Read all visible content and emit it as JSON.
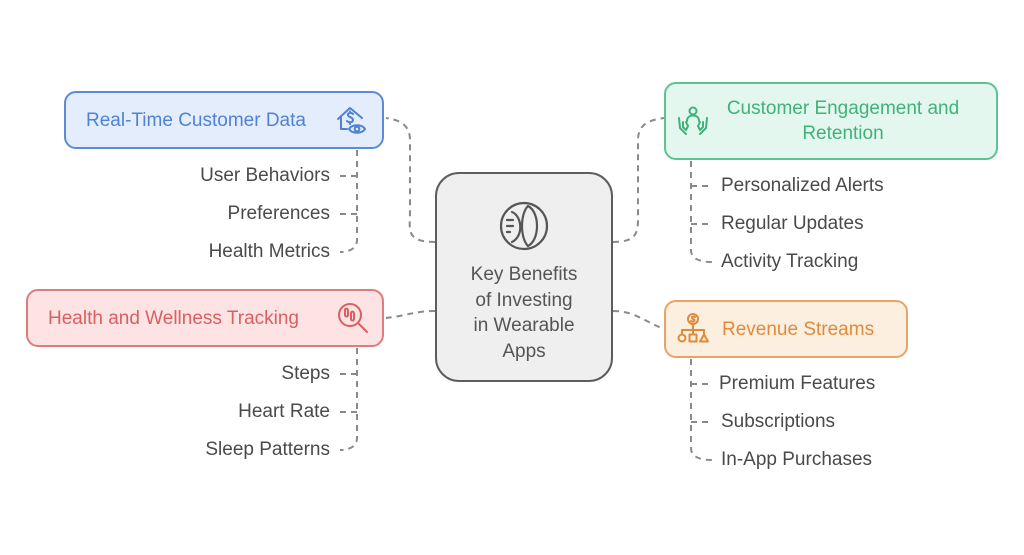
{
  "diagram": {
    "type": "mind-map",
    "center": {
      "title": "Key Benefits of Investing in Wearable Apps",
      "title_lines": [
        "Key Benefits",
        "of Investing",
        "in Wearable",
        "Apps"
      ],
      "icon": "smart-ring-icon",
      "color": "#5d5d5d"
    },
    "branches": [
      {
        "id": "realtime",
        "label": "Real-Time Customer Data",
        "icon": "house-dollar-eye-icon",
        "color": "#4f82d4",
        "fill": "#e4edfc",
        "items": [
          "User Behaviors",
          "Preferences",
          "Health Metrics"
        ]
      },
      {
        "id": "engage",
        "label": "Customer Engagement and Retention",
        "label_lines": [
          "Customer Engagement and",
          "Retention"
        ],
        "icon": "person-in-hands-icon",
        "color": "#3fb27a",
        "fill": "#e4f7ee",
        "items": [
          "Personalized Alerts",
          "Regular Updates",
          "Activity Tracking"
        ]
      },
      {
        "id": "health",
        "label": "Health and Wellness Tracking",
        "icon": "footprints-magnifier-icon",
        "color": "#d86060",
        "fill": "#fde3e3",
        "items": [
          "Steps",
          "Heart Rate",
          "Sleep Patterns"
        ]
      },
      {
        "id": "revenue",
        "label": "Revenue Streams",
        "icon": "dollar-hierarchy-icon",
        "color": "#e08a3a",
        "fill": "#fdefe0",
        "items": [
          "Premium Features",
          "Subscriptions",
          "In-App Purchases"
        ]
      }
    ],
    "connector_color": "#8a8a8a"
  }
}
